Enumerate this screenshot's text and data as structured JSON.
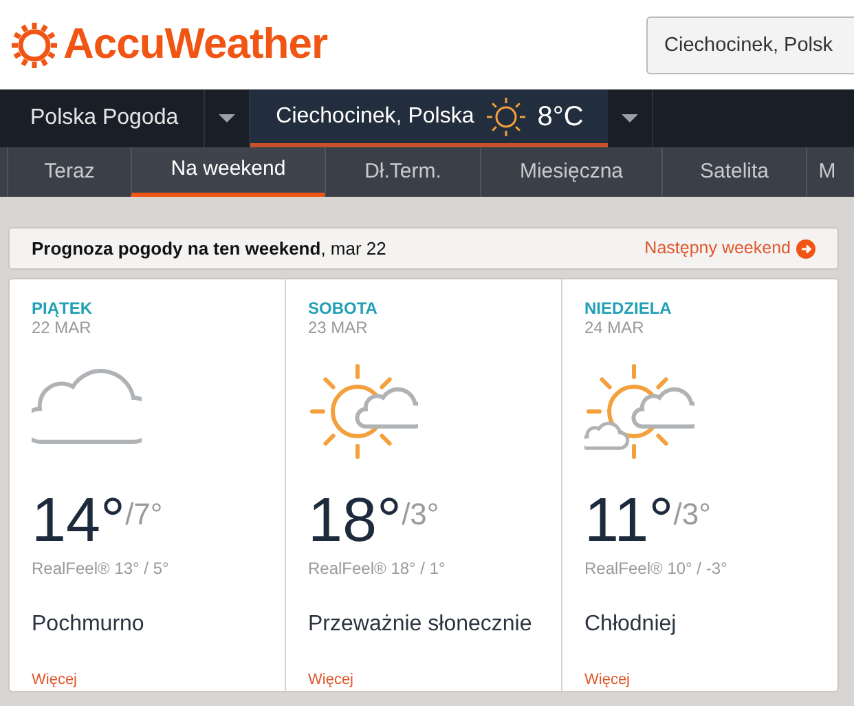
{
  "logo": {
    "text": "AccuWeather"
  },
  "search": {
    "value": "Ciechocinek, Polsk"
  },
  "nav": {
    "region": "Polska Pogoda",
    "location": "Ciechocinek, Polska",
    "temperature": "8°C"
  },
  "tabs": [
    {
      "label": "Teraz",
      "selected": false
    },
    {
      "label": "Na weekend",
      "selected": true
    },
    {
      "label": "Dł.Term.",
      "selected": false
    },
    {
      "label": "Miesięczna",
      "selected": false
    },
    {
      "label": "Satelita",
      "selected": false
    },
    {
      "label": "M",
      "selected": false
    }
  ],
  "heading": {
    "title": "**Prognoza pogody na ten weekend**, mar 22",
    "next_link": "Następny weekend"
  },
  "days": [
    {
      "day": "PIĄTEK",
      "date": "22 MAR",
      "kind": "cloudy",
      "high": "14°",
      "low": "/7°",
      "realfeel": "RealFeel® 13° / 5°",
      "condition": "Pochmurno",
      "more": "Więcej"
    },
    {
      "day": "SOBOTA",
      "date": "23 MAR",
      "kind": "sun-cloud",
      "high": "18°",
      "low": "/3°",
      "realfeel": "RealFeel® 18° / 1°",
      "condition": "Przeważnie słonecznie",
      "more": "Więcej"
    },
    {
      "day": "NIEDZIELA",
      "date": "24 MAR",
      "kind": "sun-clouds",
      "high": "11°",
      "low": "/3°",
      "realfeel": "RealFeel® 10° / -3°",
      "condition": "Chłodniej",
      "more": "Więcej"
    }
  ]
}
